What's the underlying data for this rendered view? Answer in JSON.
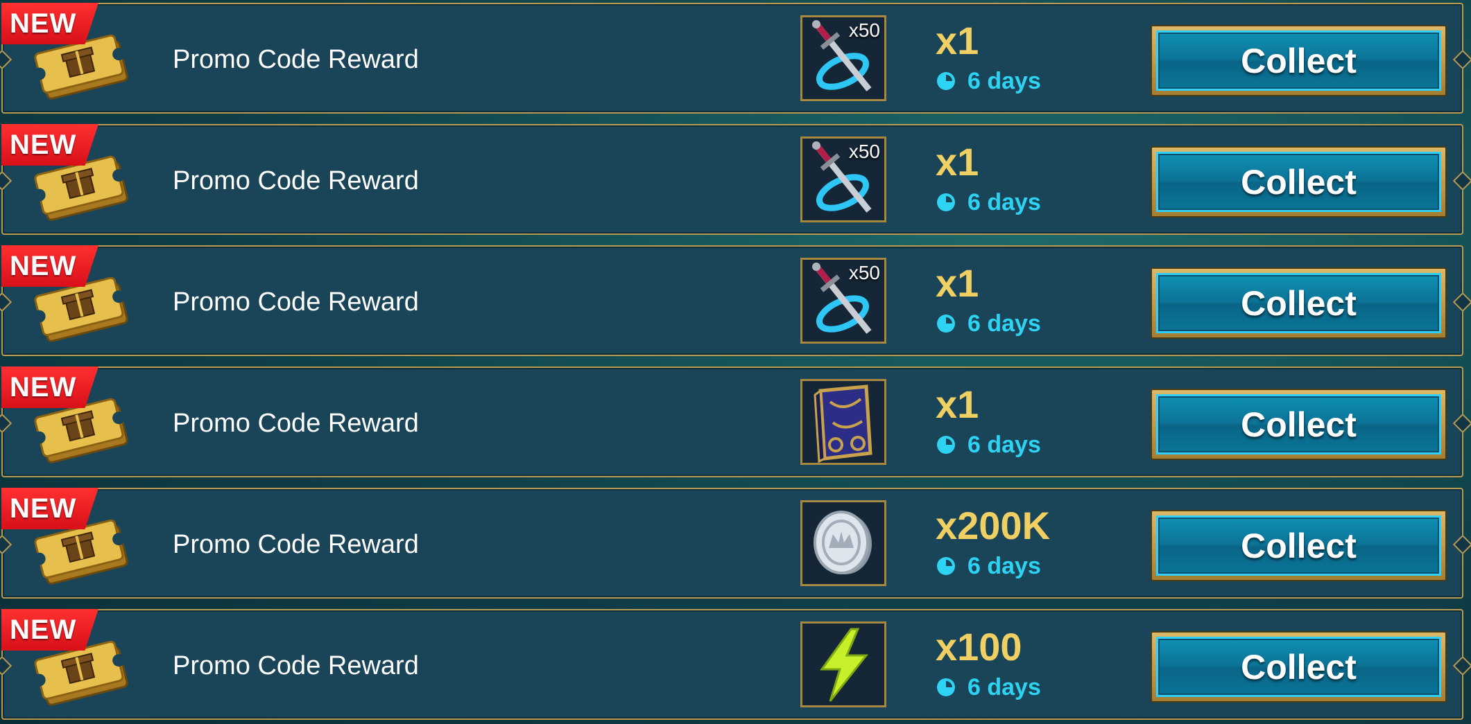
{
  "theme": {
    "row_bg": "#1a4558",
    "border_gold": "#b89a52",
    "amount_color": "#f0cf63",
    "timer_color": "#2ed3f3",
    "badge_red": "#e0121c",
    "button_blue": "#0c7396"
  },
  "rewards": [
    {
      "badge": "NEW",
      "title": "Promo Code Reward",
      "ticket_icon": "gold-gift-ticket-icon",
      "item_icon": "xp-brew-swords-icon",
      "item_icon_qty": "x50",
      "amount": "x1",
      "timer_icon": "clock-icon",
      "time_left": "6 days",
      "collect_label": "Collect"
    },
    {
      "badge": "NEW",
      "title": "Promo Code Reward",
      "ticket_icon": "gold-gift-ticket-icon",
      "item_icon": "xp-brew-swords-icon",
      "item_icon_qty": "x50",
      "amount": "x1",
      "timer_icon": "clock-icon",
      "time_left": "6 days",
      "collect_label": "Collect"
    },
    {
      "badge": "NEW",
      "title": "Promo Code Reward",
      "ticket_icon": "gold-gift-ticket-icon",
      "item_icon": "xp-brew-swords-icon",
      "item_icon_qty": "x50",
      "amount": "x1",
      "timer_icon": "clock-icon",
      "time_left": "6 days",
      "collect_label": "Collect"
    },
    {
      "badge": "NEW",
      "title": "Promo Code Reward",
      "ticket_icon": "gold-gift-ticket-icon",
      "item_icon": "ancient-tome-book-icon",
      "item_icon_qty": "",
      "amount": "x1",
      "timer_icon": "clock-icon",
      "time_left": "6 days",
      "collect_label": "Collect"
    },
    {
      "badge": "NEW",
      "title": "Promo Code Reward",
      "ticket_icon": "gold-gift-ticket-icon",
      "item_icon": "silver-coin-icon",
      "item_icon_qty": "",
      "amount": "x200K",
      "timer_icon": "clock-icon",
      "time_left": "6 days",
      "collect_label": "Collect"
    },
    {
      "badge": "NEW",
      "title": "Promo Code Reward",
      "ticket_icon": "gold-gift-ticket-icon",
      "item_icon": "energy-lightning-icon",
      "item_icon_qty": "",
      "amount": "x100",
      "timer_icon": "clock-icon",
      "time_left": "6 days",
      "collect_label": "Collect"
    }
  ]
}
